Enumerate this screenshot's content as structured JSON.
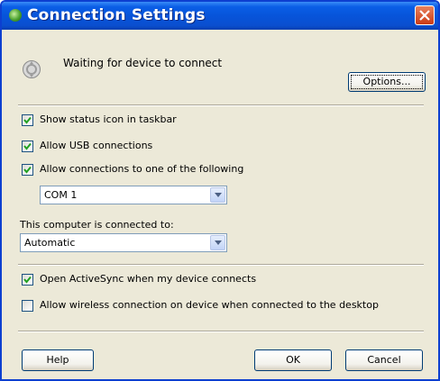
{
  "window": {
    "title": "Connection Settings"
  },
  "status": {
    "text": "Waiting for device to connect"
  },
  "buttons": {
    "options": "Options...",
    "help": "Help",
    "ok": "OK",
    "cancel": "Cancel"
  },
  "options": [
    {
      "label": "Show status icon in taskbar",
      "checked": true
    },
    {
      "label": "Allow USB connections",
      "checked": true
    },
    {
      "label": "Allow connections to one of the following",
      "checked": true
    }
  ],
  "port_select": {
    "value": "COM 1"
  },
  "internet_label": "This computer is connected to:",
  "internet_select": {
    "value": "Automatic"
  },
  "bottom_options": [
    {
      "label": "Open ActiveSync when my device connects",
      "checked": true
    },
    {
      "label": "Allow wireless connection on device when connected to the desktop",
      "checked": false
    }
  ],
  "colors": {
    "titlebar": "#0a5ee6",
    "close": "#cc3a14",
    "dialog_bg": "#ece9d8"
  }
}
